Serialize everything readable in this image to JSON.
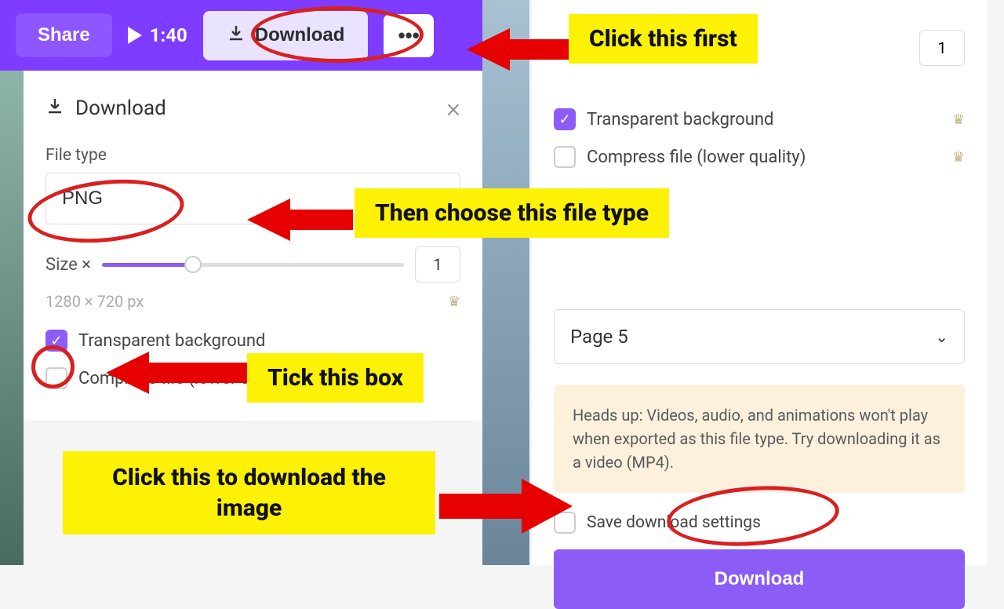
{
  "top_bar": {
    "share_label": "Share",
    "play_time": "1:40",
    "download_label": "Download",
    "more_label": "•••"
  },
  "download_panel": {
    "title": "Download",
    "file_type_label": "File type",
    "file_type_value": "PNG",
    "size_label": "Size ×",
    "size_value": "1",
    "dimensions": "1280 × 720 px",
    "transparent_label": "Transparent background",
    "compress_label": "Compress file (lower quality)"
  },
  "right_panel": {
    "size_value": "1",
    "transparent_label": "Transparent background",
    "compress_label": "Compress file (lower quality)",
    "page_select": "Page 5",
    "warning": "Heads up: Videos, audio, and animations won't play when exported as this file type. Try downloading it as a video (MP4).",
    "save_settings_label": "Save download settings",
    "download_button": "Download"
  },
  "callouts": {
    "c1": "Click this first",
    "c2": "Then choose this file type",
    "c3": "Tick this box",
    "c4": "Click this to download the image"
  }
}
